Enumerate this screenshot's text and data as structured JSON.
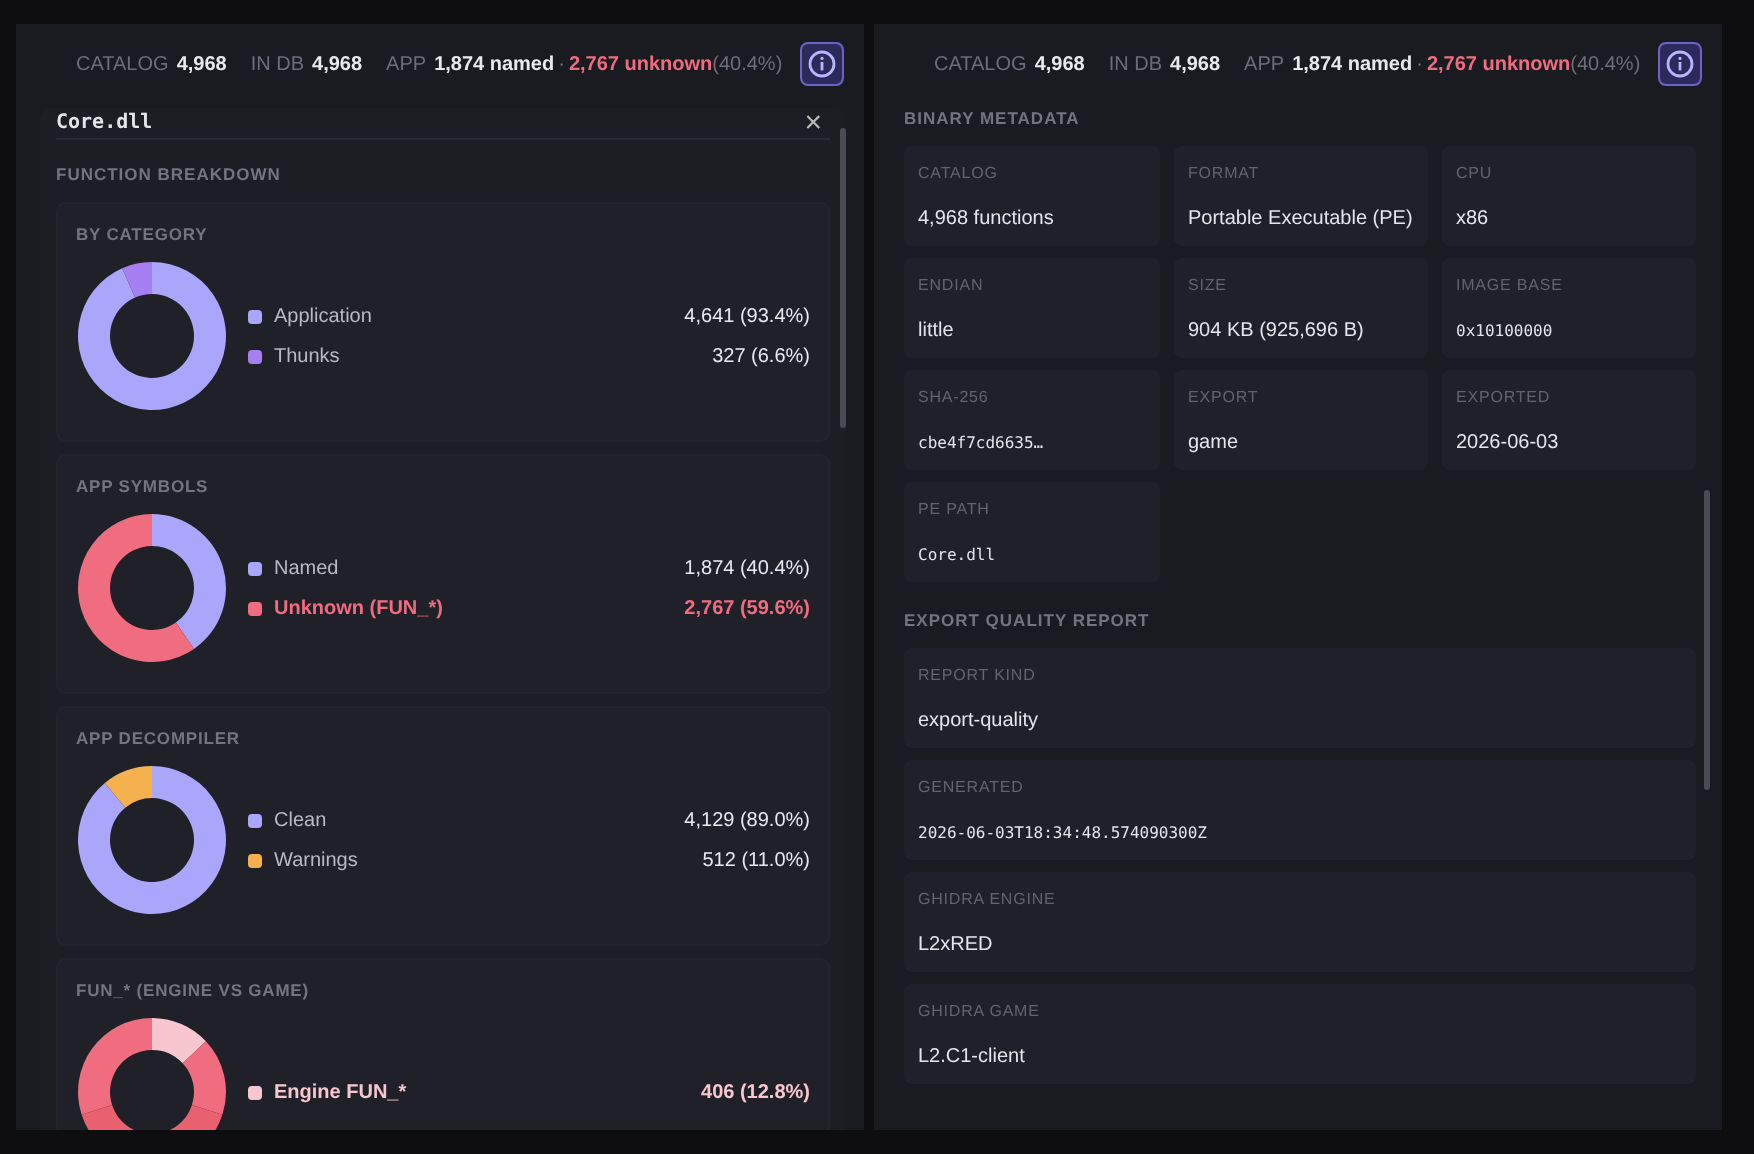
{
  "panels": [
    {
      "stats": {
        "items": [
          {
            "label": "CATALOG",
            "value": "4,968"
          },
          {
            "label": "IN DB",
            "value": "4,968"
          }
        ],
        "app": {
          "label": "APP",
          "named": "1,874 named",
          "separator": "·",
          "unknown": "2,767 unknown",
          "pct": "(40.4%)"
        }
      },
      "dialog": {
        "title": "Core.dll",
        "close": "×",
        "section": "FUNCTION BREAKDOWN",
        "cards": [
          {
            "title": "BY CATEGORY",
            "legend": [
              {
                "value": "4,641 (93.4%)",
                "color": "#a9a6fb",
                "emphasis": false
              },
              {
                "value": "327 (6.6%)",
                "color": "#a67ff2",
                "emphasis": false
              }
            ],
            "chart_data": {
              "type": "donut",
              "categories": [
                "Application",
                "Thunks"
              ],
              "values": [
                93.4,
                6.6
              ]
            }
          },
          {
            "title": "APP SYMBOLS",
            "legend": [
              {
                "value": "1,874 (40.4%)",
                "color": "#a9a6fb",
                "emphasis": false
              },
              {
                "value": "2,767 (59.6%)",
                "color": "#f06c7f",
                "emphasis": true
              }
            ],
            "chart_data": {
              "type": "donut",
              "categories": [
                "Named",
                "Unknown (FUN_*)"
              ],
              "values": [
                40.4,
                59.6
              ]
            }
          },
          {
            "title": "APP DECOMPILER",
            "legend": [
              {
                "value": "4,129 (89.0%)",
                "color": "#a9a6fb",
                "emphasis": false
              },
              {
                "value": "512 (11.0%)",
                "color": "#f4b14e",
                "emphasis": false
              }
            ],
            "chart_data": {
              "type": "donut",
              "categories": [
                "Clean",
                "Warnings"
              ],
              "values": [
                89.0,
                11.0
              ]
            }
          },
          {
            "title": "FUN_* (ENGINE VS GAME)",
            "legend": [
              {
                "label": "Engine FUN_*",
                "value": "406 (12.8%)",
                "color": "#f8c6cf",
                "emphasis": true
              }
            ]
          }
        ]
      }
    },
    {
      "stats": {
        "items": [
          {
            "label": "CATALOG",
            "value": "4,968"
          },
          {
            "label": "IN DB",
            "value": "4,968"
          }
        ],
        "app": {
          "label": "APP",
          "named": "1,874 named",
          "separator": "·",
          "unknown": "2,767 unknown",
          "pct": "(40.4%)"
        }
      },
      "metadata": {
        "title": "BINARY METADATA",
        "cells": [
          {
            "label": "CATALOG",
            "value": "4,968 functions",
            "mono": false
          },
          {
            "label": "FORMAT",
            "value": "Portable Executable (PE)",
            "mono": false
          },
          {
            "label": "CPU",
            "value": "x86",
            "mono": false
          },
          {
            "label": "ENDIAN",
            "value": "little",
            "mono": false
          },
          {
            "label": "SIZE",
            "value": "904 KB (925,696 B)",
            "mono": false
          },
          {
            "label": "IMAGE BASE",
            "value": "0x10100000",
            "mono": true
          },
          {
            "label": "SHA-256",
            "value": "cbe4f7cd6635…",
            "mono": true
          },
          {
            "label": "EXPORT",
            "value": "game",
            "mono": false
          },
          {
            "label": "EXPORTED",
            "value": "2026-06-03",
            "mono": false
          },
          {
            "label": "PE PATH",
            "value": "Core.dll",
            "mono": true
          }
        ]
      },
      "report": {
        "title": "EXPORT QUALITY REPORT",
        "cells": [
          {
            "label": "REPORT KIND",
            "value": "export-quality",
            "mono": false
          },
          {
            "label": "GENERATED",
            "value": "2026-06-03T18:34:48.574090300Z",
            "mono": true
          },
          {
            "label": "GHIDRA ENGINE",
            "value": "L2xRED",
            "mono": false
          },
          {
            "label": "GHIDRA GAME",
            "value": "L2.C1-client",
            "mono": false
          }
        ]
      }
    }
  ]
}
